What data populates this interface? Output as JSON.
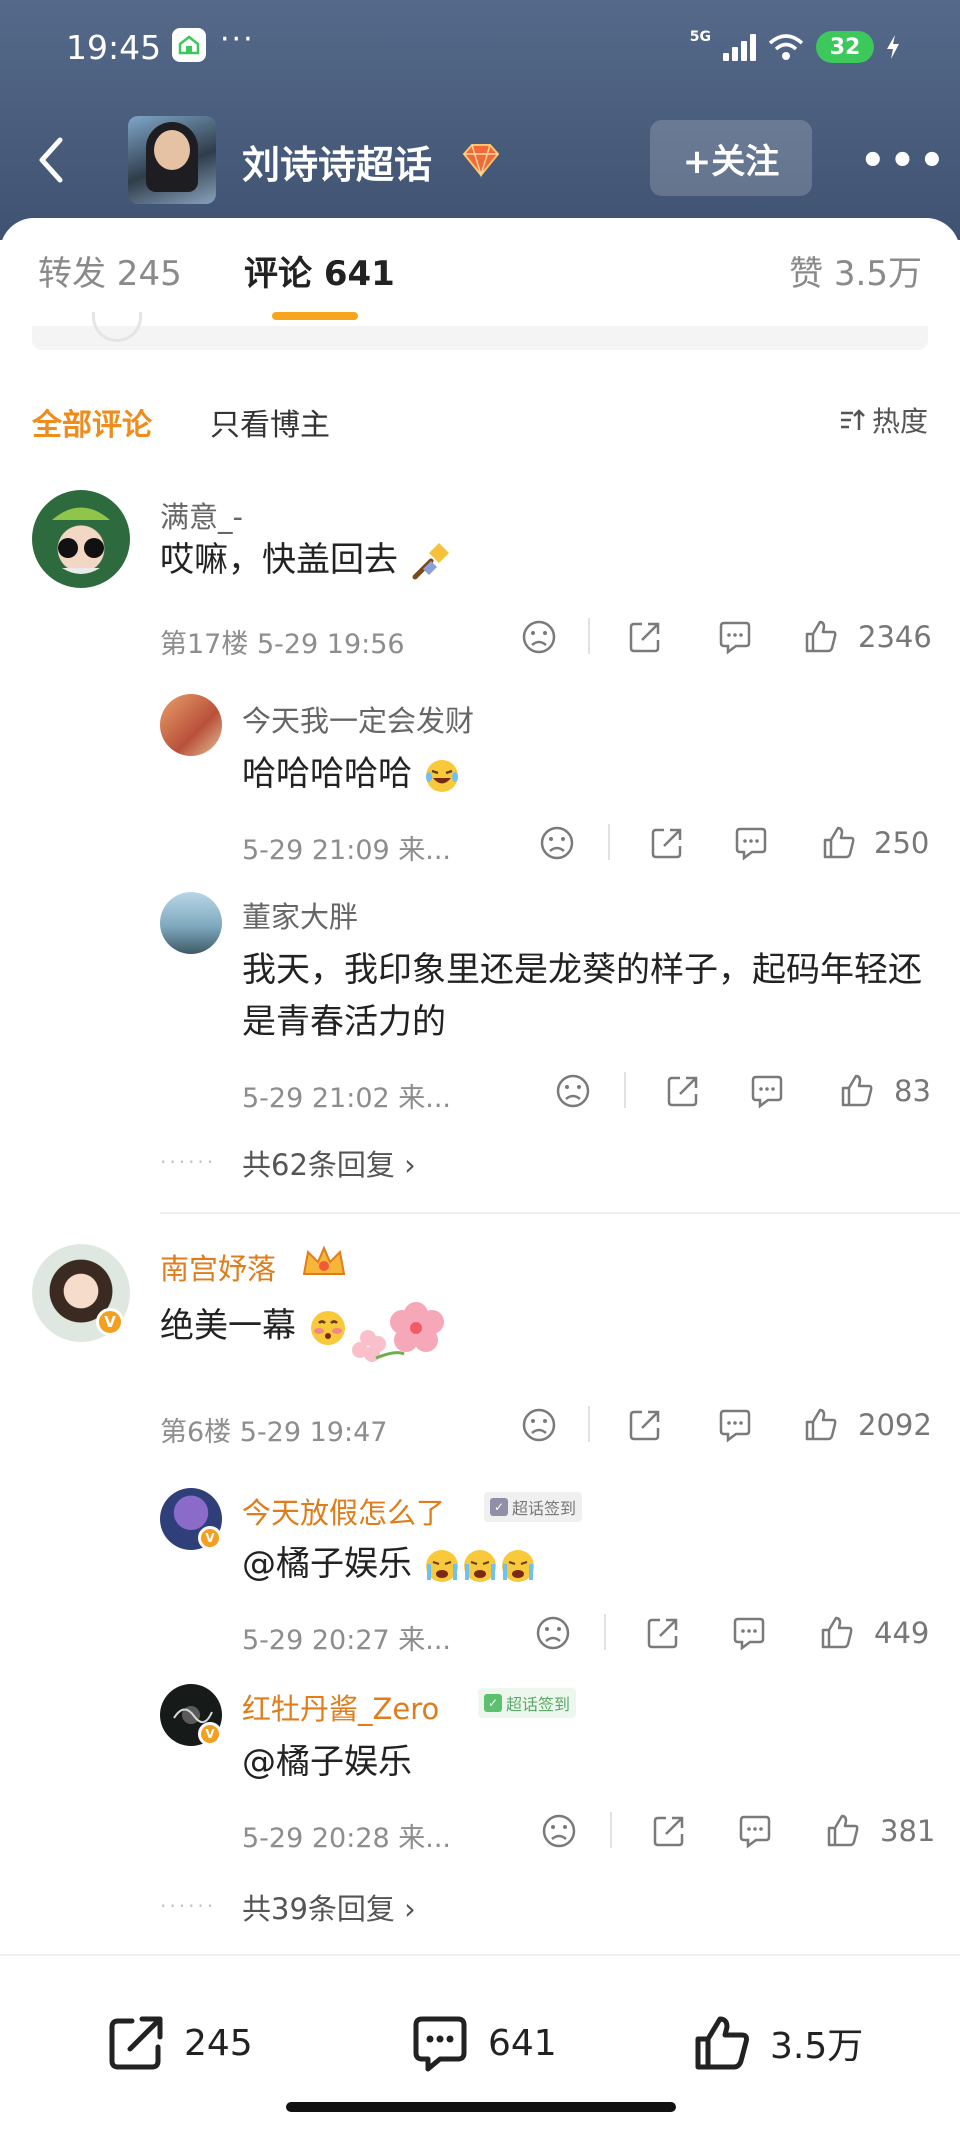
{
  "status_bar": {
    "time": "19:45",
    "dots": "···",
    "network": "5G",
    "battery": "32"
  },
  "nav": {
    "title": "刘诗诗超话",
    "follow_label": "+关注",
    "more": "•••"
  },
  "tabs": {
    "forward": "转发 245",
    "comments": "评论 641",
    "likes": "赞 3.5万"
  },
  "filters": {
    "all": "全部评论",
    "poster_only": "只看博主",
    "sort": "热度"
  },
  "comments": [
    {
      "username": "满意_-",
      "text": "哎嘛，快盖回去",
      "floor_time": "第17楼  5-29 19:56",
      "likes": "2346",
      "replies": [
        {
          "username": "今天我一定会发财",
          "text": "哈哈哈哈哈",
          "time": "5-29 21:09  来...",
          "likes": "250"
        },
        {
          "username": "董家大胖",
          "text": "我天，我印象里还是龙葵的样子，起码年轻还是青春活力的",
          "time": "5-29 21:02  来...",
          "likes": "83"
        }
      ],
      "more_replies": "共62条回复 ›"
    },
    {
      "username": "南宫妤落",
      "text": "绝美一幕",
      "floor_time": "第6楼  5-29 19:47",
      "likes": "2092",
      "replies": [
        {
          "username": "今天放假怎么了",
          "badge": "超话签到",
          "text": "@橘子娱乐",
          "time": "5-29 20:27  来...",
          "likes": "449"
        },
        {
          "username": "红牡丹酱_Zero",
          "badge": "超话签到",
          "text": "@橘子娱乐",
          "time": "5-29 20:28  来...",
          "likes": "381"
        }
      ],
      "more_replies": "共39条回复 ›"
    }
  ],
  "bottom_bar": {
    "share": "245",
    "comment": "641",
    "like": "3.5万"
  },
  "colors": {
    "header": "#4a5d7e",
    "accent": "#f08c1b",
    "underline": "#f7a51c",
    "battery": "#3cc85a"
  }
}
